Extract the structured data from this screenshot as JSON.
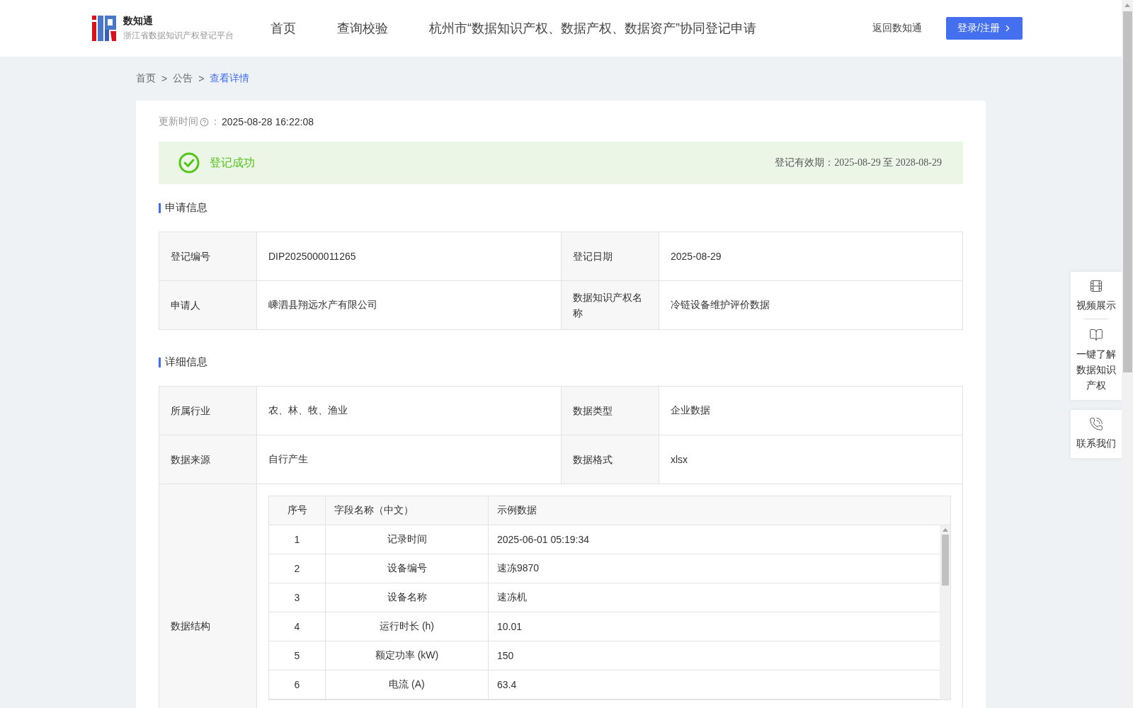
{
  "header": {
    "logo": {
      "title": "数知通",
      "subtitle": "浙江省数据知识产权登记平台"
    },
    "nav": [
      {
        "label": "首页",
        "selected": false
      },
      {
        "label": "查询校验",
        "selected": false
      },
      {
        "label": "杭州市“数据知识产权、数据产权、数据资产”协同登记申请",
        "selected": false
      }
    ],
    "back_link": "返回数知通",
    "login_button": "登录/注册"
  },
  "breadcrumb": {
    "separator": ">",
    "items": [
      {
        "label": "首页",
        "selected": false
      },
      {
        "label": "公告",
        "selected": false
      },
      {
        "label": "查看详情",
        "selected": true
      }
    ]
  },
  "update_time": {
    "label": "更新时间",
    "colon": "：",
    "value": "2025-08-28 16:22:08"
  },
  "status": {
    "text": "登记成功",
    "validity_label": "登记有效期：",
    "start": "2025-08-29",
    "connector": "至",
    "end": "2028-08-29"
  },
  "sections": [
    {
      "title": "申请信息",
      "rows": [
        {
          "kind": "pair",
          "cells": [
            {
              "label": "登记编号",
              "value": "DIP2025000011265"
            },
            {
              "label": "登记日期",
              "value": "2025-08-29"
            }
          ]
        },
        {
          "kind": "pair",
          "cells": [
            {
              "label": "申请人",
              "value": "嵊泗县翔远水产有限公司"
            },
            {
              "label": "数据知识产权名称",
              "value": "冷链设备维护评价数据"
            }
          ]
        }
      ]
    },
    {
      "title": "详细信息",
      "rows": [
        {
          "kind": "pair",
          "cells": [
            {
              "label": "所属行业",
              "value": "农、林、牧、渔业"
            },
            {
              "label": "数据类型",
              "value": "企业数据"
            }
          ]
        },
        {
          "kind": "pair",
          "cells": [
            {
              "label": "数据来源",
              "value": "自行产生"
            },
            {
              "label": "数据格式",
              "value": "xlsx"
            }
          ]
        },
        {
          "kind": "table",
          "label": "数据结构",
          "table": {
            "columns": [
              "序号",
              "字段名称（中文）",
              "示例数据"
            ],
            "rows": [
              [
                "1",
                "记录时间",
                "2025-06-01 05:19:34"
              ],
              [
                "2",
                "设备编号",
                "速冻9870"
              ],
              [
                "3",
                "设备名称",
                "速冻机"
              ],
              [
                "4",
                "运行时长 (h)",
                "10.01"
              ],
              [
                "5",
                "额定功率 (kW)",
                "150"
              ],
              [
                "6",
                "电流 (A)",
                "63.4"
              ]
            ]
          }
        }
      ]
    }
  ],
  "float_panel": [
    {
      "items": [
        {
          "kind": "video",
          "label": "视频展示"
        },
        {
          "kind": "book",
          "label": "一键了解数据知识产权"
        }
      ]
    },
    {
      "items": [
        {
          "kind": "phone",
          "label": "联系我们"
        }
      ]
    }
  ]
}
